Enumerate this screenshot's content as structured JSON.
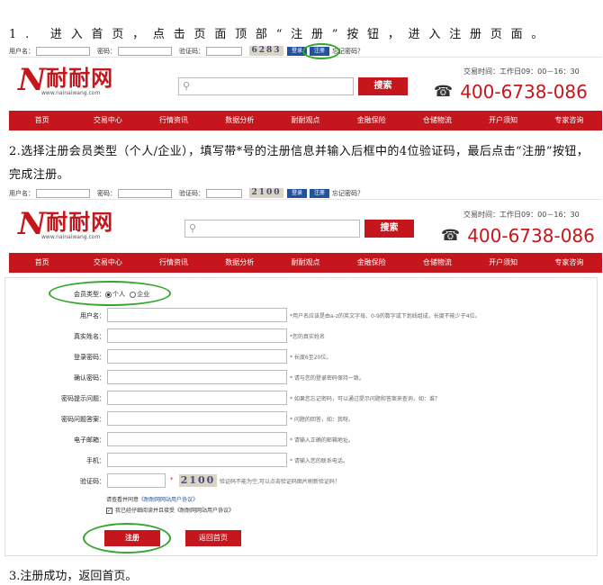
{
  "steps": {
    "step1": "1. 进入首页，点击页面顶部“注册”按钮，进入注册页面。",
    "step2": "2.选择注册会员类型（个人/企业），填写带*号的注册信息并输入后框中的4位验证码，最后点击“注册”按钮，完成注册。",
    "step3": "3.注册成功，返回首页。"
  },
  "login_bar": {
    "username_label": "用户名：",
    "password_label": "密码：",
    "captcha_label": "验证码：",
    "captcha_top": "6283",
    "captcha_bottom": "2100",
    "login_button": "登录",
    "register_button": "注册",
    "forgot_link": "忘记密码？"
  },
  "header": {
    "logo_mark": "N",
    "logo_name": "耐耐网",
    "logo_url": "www.nainaiwang.com",
    "search_button": "搜索",
    "search_icon": "magnifier-icon",
    "hours": "交易时间：工作日09：00－16：30",
    "phone_icon": "phone-icon",
    "phone": "400-6738-086"
  },
  "nav": [
    "首页",
    "交易中心",
    "行情资讯",
    "数据分析",
    "耐耐观点",
    "金融保险",
    "仓储物流",
    "开户须知",
    "专家咨询"
  ],
  "form": {
    "member_type_label": "会员类型：",
    "member_type_personal": "个人",
    "member_type_company": "企业",
    "fields": [
      {
        "label": "用户名：",
        "hint": "*用户名应该是由a-z的英文字母、0-9的数字或下划线组成，长度不能少于4位。"
      },
      {
        "label": "真实姓名：",
        "hint": "*您的真实姓名"
      },
      {
        "label": "登录密码：",
        "hint": "* 长度6至20位。"
      },
      {
        "label": "确认密码：",
        "hint": "* 请与您的登录密码保持一致。"
      },
      {
        "label": "密码提示问题：",
        "hint": "* 如果您忘记密码，可以通过提示问题和答案来查询，如：谁？"
      },
      {
        "label": "密码问题答案：",
        "hint": "* 问题的回答，如：我呀。"
      },
      {
        "label": "电子邮箱：",
        "hint": "* 请输入正确的邮箱地址。"
      },
      {
        "label": "手机：",
        "hint": "* 请输入您的联系电话。"
      }
    ],
    "captcha_label": "验证码：",
    "captcha_value": "2100",
    "captcha_hint": "验证码不能为空,可以点击验证码图片刷新验证码！",
    "agreement_prompt": "请查看并同意",
    "agreement_link": "《耐耐网网站用户协议》",
    "agreement_check": "我已经仔细阅读并且接受",
    "agreement_check_link": "《耐耐网网站用户协议》",
    "register_button": "注册",
    "back_button": "返回首页"
  }
}
